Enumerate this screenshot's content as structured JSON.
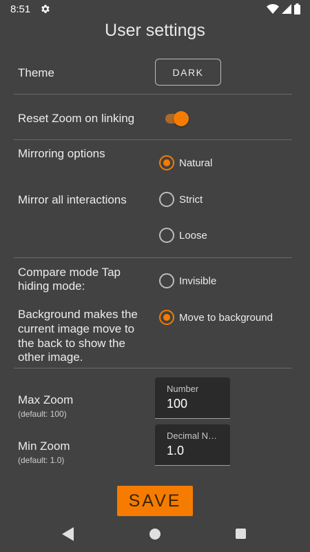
{
  "status_bar": {
    "time": "8:51",
    "icons": [
      "gear-icon",
      "wifi-icon",
      "signal-icon",
      "battery-icon"
    ]
  },
  "title": "User settings",
  "theme": {
    "label": "Theme",
    "button_label": "DARK"
  },
  "reset_zoom": {
    "label": "Reset Zoom on linking",
    "enabled": true
  },
  "mirroring": {
    "label": "Mirroring options",
    "sublabel": "Mirror all interactions",
    "options": [
      {
        "label": "Natural",
        "selected": true
      },
      {
        "label": "Strict",
        "selected": false
      },
      {
        "label": "Loose",
        "selected": false
      }
    ]
  },
  "compare": {
    "label_lines": [
      "Compare mode Tap",
      "hiding mode:"
    ],
    "desc_lines": [
      "Background makes the",
      "current image move to",
      "the back to show the",
      "other image."
    ],
    "options": [
      {
        "label": "Invisible",
        "selected": false
      },
      {
        "label": "Move to background",
        "selected": true
      }
    ]
  },
  "max_zoom": {
    "label": "Max Zoom",
    "default_text": "(default: 100)",
    "hint": "Number",
    "value": "100"
  },
  "min_zoom": {
    "label": "Min Zoom",
    "default_text": "(default: 1.0)",
    "hint": "Decimal N…",
    "value": "1.0"
  },
  "save_label": "SAVE",
  "colors": {
    "accent": "#f57c00",
    "background": "#424242",
    "field_background": "#2a2a2a"
  },
  "nav_bar": {
    "icons": [
      "back-icon",
      "home-icon",
      "recent-apps-icon"
    ]
  }
}
